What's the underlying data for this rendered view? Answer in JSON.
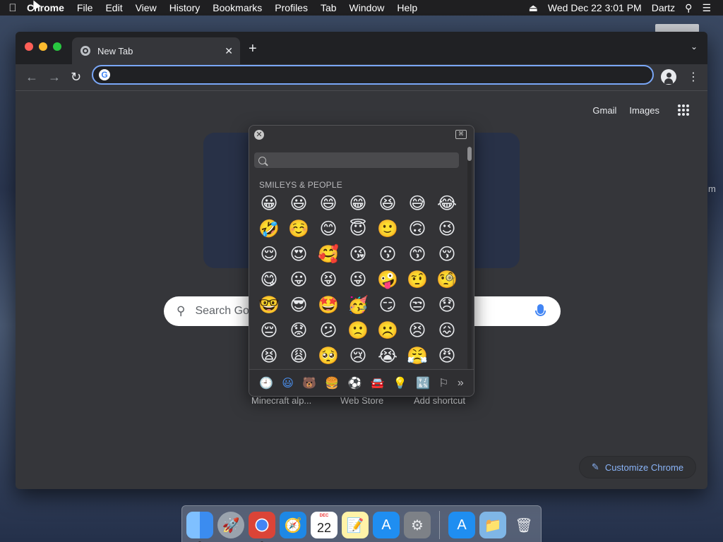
{
  "menubar": {
    "app": "Chrome",
    "items": [
      "File",
      "Edit",
      "View",
      "History",
      "Bookmarks",
      "Profiles",
      "Tab",
      "Window",
      "Help"
    ],
    "datetime": "Wed Dec 22  3:01 PM",
    "user": "Dartz"
  },
  "tab": {
    "title": "New Tab"
  },
  "omnibox": {
    "value": ""
  },
  "ntp": {
    "gmail": "Gmail",
    "images": "Images",
    "search_placeholder": "Search Go",
    "shortcuts": [
      "Minecraft alp...",
      "Web Store",
      "Add shortcut"
    ],
    "customize": "Customize Chrome"
  },
  "emoji_picker": {
    "section_title": "SMILEYS & PEOPLE",
    "emojis": [
      "😀",
      "😃",
      "😄",
      "😁",
      "😆",
      "😅",
      "😂",
      "🤣",
      "☺️",
      "😊",
      "😇",
      "🙂",
      "🙃",
      "😉",
      "😌",
      "😍",
      "🥰",
      "😘",
      "😗",
      "😙",
      "😚",
      "😋",
      "😛",
      "😝",
      "😜",
      "🤪",
      "🤨",
      "🧐",
      "🤓",
      "😎",
      "🤩",
      "🥳",
      "😏",
      "😒",
      "😞",
      "😔",
      "😟",
      "😕",
      "🙁",
      "☹️",
      "😣",
      "😖",
      "😫",
      "😩",
      "🥺",
      "😢",
      "😭",
      "😤",
      "😠"
    ],
    "categories": [
      "🕘",
      "😃",
      "🐻",
      "🍔",
      "⚽",
      "🚘",
      "💡",
      "🔣",
      "⚐",
      "»"
    ]
  },
  "desktop_fragment": "m",
  "dock": {
    "calendar_month": "DEC",
    "calendar_day": "22"
  }
}
